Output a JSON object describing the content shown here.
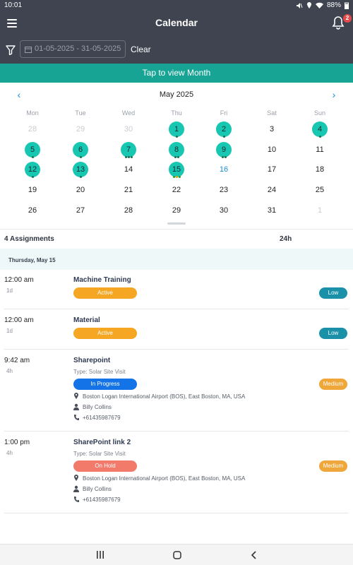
{
  "status": {
    "time": "10:01",
    "battery": "88%"
  },
  "header": {
    "title": "Calendar",
    "notifications": "2"
  },
  "filter": {
    "date_range": "01-05-2025 - 31-05-2025",
    "clear_label": "Clear"
  },
  "view_month_label": "Tap to view Month",
  "calendar": {
    "month": "May 2025",
    "weekdays": [
      "Mon",
      "Tue",
      "Wed",
      "Thu",
      "Fri",
      "Sat",
      "Sun"
    ],
    "weeks": [
      [
        {
          "d": "28",
          "t": "other"
        },
        {
          "d": "29",
          "t": "other"
        },
        {
          "d": "30",
          "t": "other"
        },
        {
          "d": "1",
          "t": "ev",
          "dots": [
            "#1f6d4f"
          ]
        },
        {
          "d": "2",
          "t": "ev",
          "dots": [
            "#1f6d4f"
          ]
        },
        {
          "d": "3",
          "t": ""
        },
        {
          "d": "4",
          "t": "ev",
          "dots": [
            "#1f6d4f"
          ]
        }
      ],
      [
        {
          "d": "5",
          "t": "ev",
          "dots": [
            "#1f6d4f"
          ]
        },
        {
          "d": "6",
          "t": "ev",
          "dots": [
            "#1f6d4f"
          ]
        },
        {
          "d": "7",
          "t": "ev",
          "dots": [
            "#1f6d4f",
            "#1f6d4f",
            "#1f6d4f"
          ]
        },
        {
          "d": "8",
          "t": "ev",
          "dots": [
            "#1f6d4f",
            "#1f6d4f"
          ]
        },
        {
          "d": "9",
          "t": "ev",
          "dots": [
            "#1f6d4f",
            "#1f6d4f"
          ]
        },
        {
          "d": "10",
          "t": ""
        },
        {
          "d": "11",
          "t": ""
        }
      ],
      [
        {
          "d": "12",
          "t": "ev",
          "dots": [
            "#1f6d4f"
          ]
        },
        {
          "d": "13",
          "t": "ev",
          "dots": [
            "#1f6d4f"
          ]
        },
        {
          "d": "14",
          "t": ""
        },
        {
          "d": "15",
          "t": "ev",
          "dots": [
            "#3a9a3a",
            "#e0a800",
            "#3a9a3a"
          ]
        },
        {
          "d": "16",
          "t": "today"
        },
        {
          "d": "17",
          "t": ""
        },
        {
          "d": "18",
          "t": ""
        }
      ],
      [
        {
          "d": "19",
          "t": ""
        },
        {
          "d": "20",
          "t": ""
        },
        {
          "d": "21",
          "t": ""
        },
        {
          "d": "22",
          "t": ""
        },
        {
          "d": "23",
          "t": ""
        },
        {
          "d": "24",
          "t": ""
        },
        {
          "d": "25",
          "t": ""
        }
      ],
      [
        {
          "d": "26",
          "t": ""
        },
        {
          "d": "27",
          "t": ""
        },
        {
          "d": "28",
          "t": ""
        },
        {
          "d": "29",
          "t": ""
        },
        {
          "d": "30",
          "t": ""
        },
        {
          "d": "31",
          "t": ""
        },
        {
          "d": "1",
          "t": "other"
        }
      ]
    ]
  },
  "assignments": {
    "count_label": "4 Assignments",
    "hours": "24h",
    "date_header": "Thursday, May 15"
  },
  "items": [
    {
      "time": "12:00 am",
      "duration": "1d",
      "title": "Machine Training",
      "status": "Active",
      "priority": "Low"
    },
    {
      "time": "12:00 am",
      "duration": "1d",
      "title": "Material",
      "status": "Active",
      "priority": "Low"
    },
    {
      "time": "9:42 am",
      "duration": "4h",
      "title": "Sharepoint",
      "type": "Type: Solar Site Visit",
      "status": "In Progress",
      "priority": "Medium",
      "location": "Boston Logan International Airport (BOS), East Boston, MA, USA",
      "person": "Billy Collins",
      "phone": "+61435987679"
    },
    {
      "time": "1:00 pm",
      "duration": "4h",
      "title": "SharePoint link 2",
      "type": "Type: Solar Site Visit",
      "status": "On Hold",
      "priority": "Medium",
      "location": "Boston Logan International Airport (BOS), East Boston, MA, USA",
      "person": "Billy Collins",
      "phone": "+61435987679"
    }
  ],
  "colors": {
    "header": "#3f4450",
    "accent": "#17a495",
    "event_day": "#17c7b2",
    "active": "#f5a623",
    "in_progress": "#1473e6",
    "on_hold": "#f27a6b",
    "low": "#1a91a8",
    "medium": "#f0a73a"
  },
  "icons": [
    "menu-icon",
    "bell-icon",
    "filter-icon",
    "calendar-icon",
    "chevron-left-icon",
    "chevron-right-icon",
    "location-pin-icon",
    "person-icon",
    "phone-icon"
  ]
}
